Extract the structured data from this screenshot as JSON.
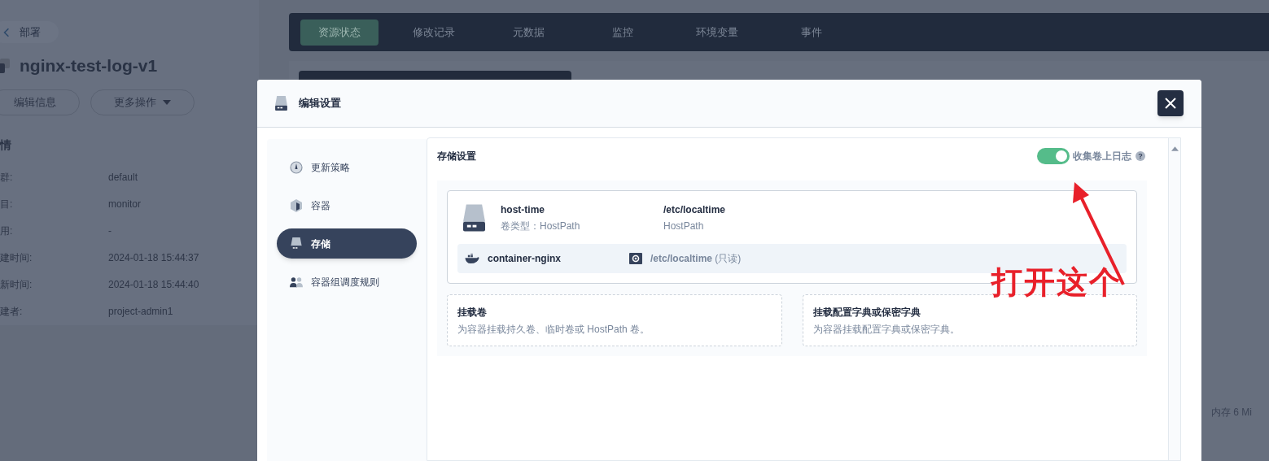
{
  "background": {
    "breadcrumb": "部署",
    "title": "nginx-test-log-v1",
    "buttons": [
      {
        "label": "编辑信息",
        "kind": "plain"
      },
      {
        "label": "更多操作",
        "kind": "dropdown"
      }
    ],
    "details_heading": "情",
    "details": [
      {
        "label": "群:",
        "value": "default"
      },
      {
        "label": "目:",
        "value": "monitor"
      },
      {
        "label": "用:",
        "value": "-"
      },
      {
        "label": "建时间:",
        "value": "2024-01-18 15:44:37"
      },
      {
        "label": "新时间:",
        "value": "2024-01-18 15:44:40"
      },
      {
        "label": "建者:",
        "value": "project-admin1"
      }
    ],
    "tabs": [
      {
        "label": "资源状态",
        "selected": true
      },
      {
        "label": "修改记录",
        "selected": false
      },
      {
        "label": "元数据",
        "selected": false
      },
      {
        "label": "监控",
        "selected": false
      },
      {
        "label": "环境变量",
        "selected": false
      },
      {
        "label": "事件",
        "selected": false
      }
    ],
    "resource_text": "内存 6 Mi"
  },
  "dialog": {
    "title": "编辑设置",
    "nav": [
      {
        "label": "更新策略",
        "kind": "gauge",
        "selected": false
      },
      {
        "label": "容器",
        "kind": "cube",
        "selected": false
      },
      {
        "label": "存储",
        "kind": "disk",
        "selected": true
      },
      {
        "label": "容器组调度规则",
        "kind": "people",
        "selected": false
      }
    ],
    "storage": {
      "title": "存储设置",
      "collect_logs": {
        "label": "收集卷上日志",
        "on": true,
        "help": "?"
      },
      "volumes": [
        {
          "name": "host-time",
          "type": "卷类型：HostPath",
          "path": "/etc/localtime",
          "path_type": "HostPath",
          "mounts": [
            {
              "container": "container-nginx",
              "mount": "**/etc/localtime** (只读)"
            }
          ]
        }
      ],
      "add_options": [
        {
          "title": "挂载卷",
          "description": "为容器挂载持久卷、临时卷或 HostPath 卷。"
        },
        {
          "title": "挂载配置字典或保密字典",
          "description": "为容器挂载配置字典或保密字典。"
        }
      ]
    }
  },
  "annotation": {
    "text": "打开这个"
  }
}
